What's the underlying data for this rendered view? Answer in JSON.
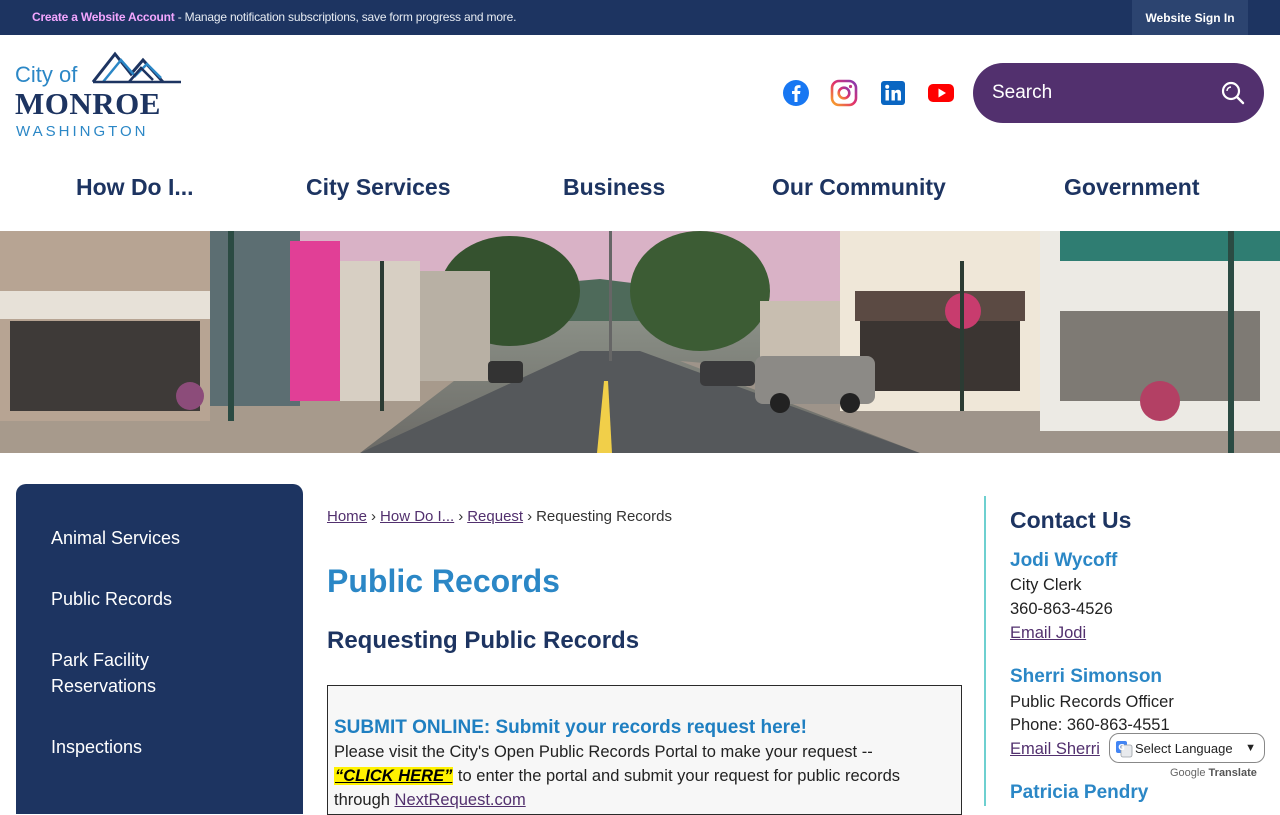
{
  "topbar": {
    "promo_link": "Create a Website Account",
    "promo_text": " - Manage notification subscriptions, save form progress and more.",
    "signin_label": "Website Sign In"
  },
  "logo": {
    "line1": "City of",
    "line2": "MONROE",
    "line3": "WASHINGTON"
  },
  "social": {
    "icons": [
      "facebook-icon",
      "instagram-icon",
      "linkedin-icon",
      "youtube-icon"
    ],
    "colors": {
      "facebook": "#1877f2",
      "instagram": "#c13584",
      "linkedin": "#0a66c2",
      "youtube": "#ff0000"
    }
  },
  "search": {
    "placeholder": "Search"
  },
  "nav": {
    "items": [
      {
        "label": "How Do I..."
      },
      {
        "label": "City Services"
      },
      {
        "label": "Business"
      },
      {
        "label": "Our Community"
      },
      {
        "label": "Government"
      }
    ]
  },
  "sidebar": {
    "items": [
      {
        "label": "Animal Services"
      },
      {
        "label": "Public Records"
      },
      {
        "label": "Park Facility Reservations"
      },
      {
        "label": "Inspections"
      }
    ]
  },
  "breadcrumb": {
    "items": [
      "Home",
      "How Do I...",
      "Request"
    ],
    "current": "Requesting Records",
    "separator": "›"
  },
  "main": {
    "title": "Public Records",
    "subtitle": "Requesting Public Records",
    "box": {
      "heading": "SUBMIT ONLINE: Submit your records request here!",
      "line1": "Please visit the City's Open Public Records Portal to make your request --",
      "click_here": "“CLICK HERE”",
      "line2_rest": " to enter the portal and submit your request for public records",
      "line3_start": "through ",
      "line3_link": "NextRequest.com"
    }
  },
  "contact": {
    "heading": "Contact Us",
    "people": [
      {
        "name": "Jodi Wycoff",
        "title": "City Clerk",
        "phone": "360-863-4526",
        "email_label": "Email Jodi"
      },
      {
        "name": "Sherri Simonson",
        "title": "Public Records Officer",
        "phone": "Phone: 360-863-4551",
        "email_label": "Email Sherri"
      },
      {
        "name": "Patricia Pendry"
      }
    ]
  },
  "translate": {
    "label": "Select Language",
    "powered": "Google",
    "translate_word": "Translate"
  },
  "colors": {
    "navy": "#1d3461",
    "blue": "#2b87c6",
    "purple": "#52306e",
    "teal_divider": "#6ed0d0"
  }
}
